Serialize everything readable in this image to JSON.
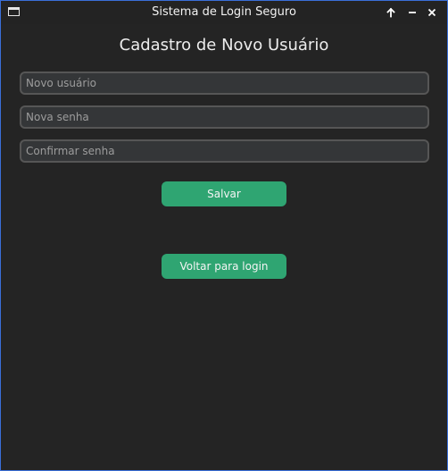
{
  "window": {
    "title": "Sistema de Login Seguro",
    "controls": [
      "maximize-arrow-icon",
      "minimize-icon",
      "close-icon"
    ]
  },
  "form": {
    "heading": "Cadastro de Novo Usuário",
    "fields": [
      {
        "placeholder": "Novo usuário",
        "value": ""
      },
      {
        "placeholder": "Nova senha",
        "value": ""
      },
      {
        "placeholder": "Confirmar senha",
        "value": ""
      }
    ],
    "save_label": "Salvar",
    "back_label": "Voltar para login"
  },
  "colors": {
    "background": "#242424",
    "field_bg": "#343638",
    "field_border": "#565656",
    "accent": "#2fa572",
    "window_border": "#3a6fd8"
  }
}
